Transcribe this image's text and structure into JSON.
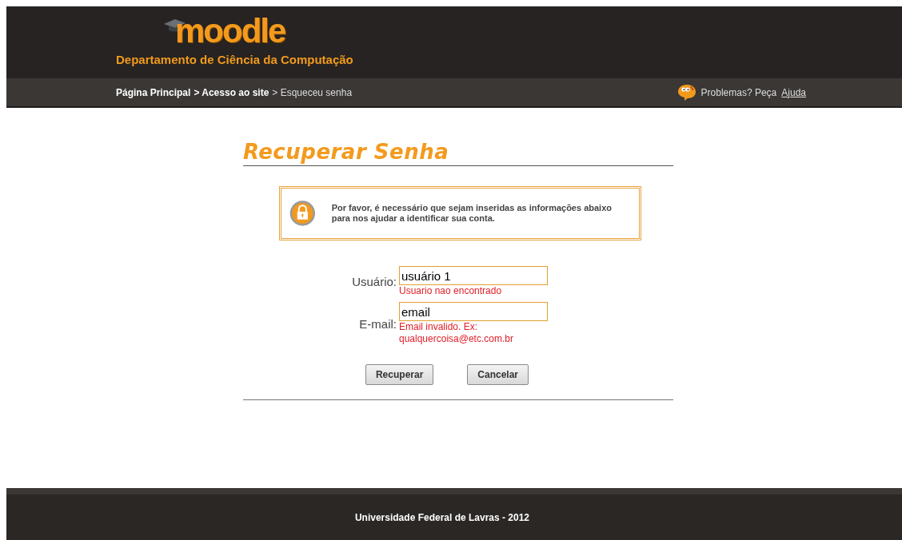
{
  "header": {
    "logo": "moodle",
    "department": "Departamento de Ciência da Computação"
  },
  "breadcrumb": [
    {
      "label": "Página Principal",
      "kind": "link"
    },
    {
      "label": "> Acesso ao site",
      "kind": "link"
    },
    {
      "label": "> Esqueceu senha",
      "kind": "current"
    }
  ],
  "help": {
    "text": "Problemas? Peça",
    "link": "Ajuda"
  },
  "title": "Recuperar Senha",
  "notice": "Por favor, é necessário que sejam inseridas as informações abaixo para nos ajudar a identificar sua conta.",
  "fields": [
    {
      "label": "Usuário:",
      "value": "usuário 1",
      "error": "Usuario nao encontrado"
    },
    {
      "label": "E-mail:",
      "value": "email",
      "error": "Email invalido. Ex: qualquercoisa@etc.com.br"
    }
  ],
  "buttons": [
    "Recuperar",
    "Cancelar"
  ],
  "footer": "Universidade Federal de Lavras - 2012"
}
